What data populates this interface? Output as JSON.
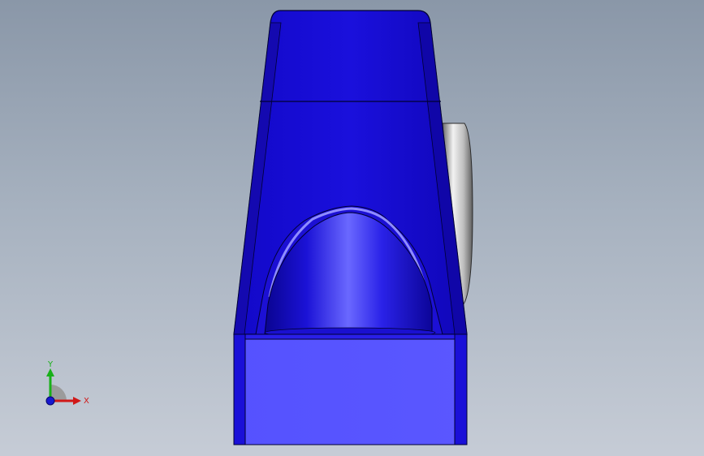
{
  "viewport": {
    "background_top": "#8a97a8",
    "background_bottom": "#c6ccd6"
  },
  "model": {
    "body_color": "#1a0fd8",
    "face_color": "#5a57ff",
    "edge_color": "#000033",
    "insert_color": "#c8c8c8"
  },
  "triad": {
    "x_label": "X",
    "y_label": "Y",
    "x_color": "#d01818",
    "y_color": "#18b018",
    "z_color": "#1818d0"
  }
}
